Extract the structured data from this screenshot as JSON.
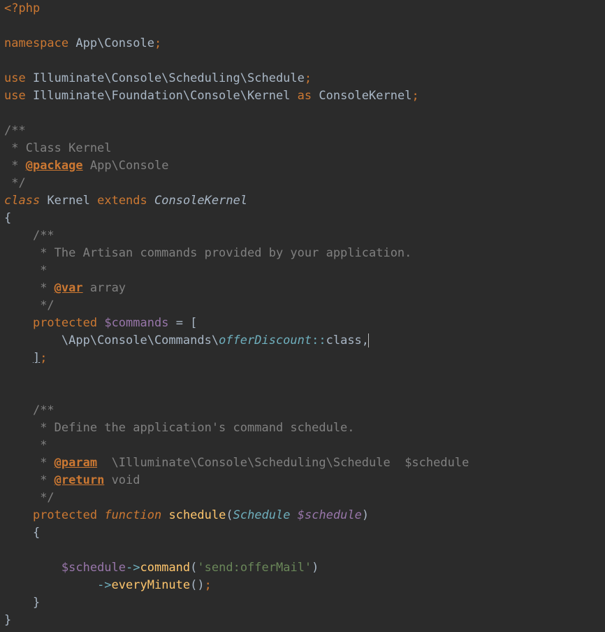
{
  "line01": {
    "open_tag": "<?php"
  },
  "line03": {
    "kw_namespace": "namespace",
    "ns": " App\\Console",
    "semi": ";"
  },
  "line05": {
    "kw_use": "use",
    "path": " Illuminate\\Console\\Scheduling\\Schedule",
    "semi": ";"
  },
  "line06": {
    "kw_use": "use",
    "path": " Illuminate\\Foundation\\Console\\Kernel ",
    "kw_as": "as",
    "alias": " ConsoleKernel",
    "semi": ";"
  },
  "line08": {
    "txt": "/**"
  },
  "line09": {
    "txt": " * Class Kernel"
  },
  "line10": {
    "prefix": " * ",
    "tag": "@package",
    "rest": " App\\Console"
  },
  "line11": {
    "txt": " */"
  },
  "line12": {
    "kw_class": "class",
    "sp1": " ",
    "name": "Kernel",
    "sp2": " ",
    "kw_extends": "extends",
    "sp3": " ",
    "parent": "ConsoleKernel"
  },
  "line13": {
    "brace": "{"
  },
  "line14": {
    "indent": "    ",
    "txt": "/**"
  },
  "line15": {
    "indent": "    ",
    "txt": " * The Artisan commands provided by your application."
  },
  "line16": {
    "indent": "    ",
    "txt": " *"
  },
  "line17": {
    "indent": "    ",
    "prefix": " * ",
    "tag": "@var",
    "rest": " array"
  },
  "line18": {
    "indent": "    ",
    "txt": " */"
  },
  "line19": {
    "indent": "    ",
    "kw": "protected",
    "sp": " ",
    "var": "$commands",
    "eq": " = ",
    "brk": "["
  },
  "line20": {
    "indent": "        ",
    "path": "\\App\\Console\\Commands\\",
    "cls": "offerDiscount",
    "dblc": "::",
    "rest": "class,",
    "caret": ""
  },
  "line21": {
    "indent": "    ",
    "brk": "]",
    "semi": ";"
  },
  "line24": {
    "indent": "    ",
    "txt": "/**"
  },
  "line25": {
    "indent": "    ",
    "txt": " * Define the application's command schedule."
  },
  "line26": {
    "indent": "    ",
    "txt": " *"
  },
  "line27": {
    "indent": "    ",
    "prefix": " * ",
    "tag": "@param",
    "rest": "  \\Illuminate\\Console\\Scheduling\\Schedule  $schedule"
  },
  "line28": {
    "indent": "    ",
    "prefix": " * ",
    "tag": "@return",
    "rest": " void"
  },
  "line29": {
    "indent": "    ",
    "txt": " */"
  },
  "line30": {
    "indent": "    ",
    "kw": "protected",
    "sp1": " ",
    "kw_fn": "function",
    "sp2": " ",
    "name": "schedule",
    "lp": "(",
    "type": "Schedule",
    "sp3": " ",
    "var": "$schedule",
    "rp": ")"
  },
  "line31": {
    "indent": "    ",
    "brace": "{"
  },
  "line33": {
    "indent": "        ",
    "var": "$schedule",
    "arrow": "->",
    "method": "command",
    "lp": "(",
    "str": "'send:offerMail'",
    "rp": ")"
  },
  "line34": {
    "indent": "             ",
    "arrow": "->",
    "method": "everyMinute",
    "lp": "(",
    "rp": ")",
    "semi": ";"
  },
  "line35": {
    "indent": "    ",
    "brace": "}"
  },
  "line36": {
    "brace": "}"
  }
}
